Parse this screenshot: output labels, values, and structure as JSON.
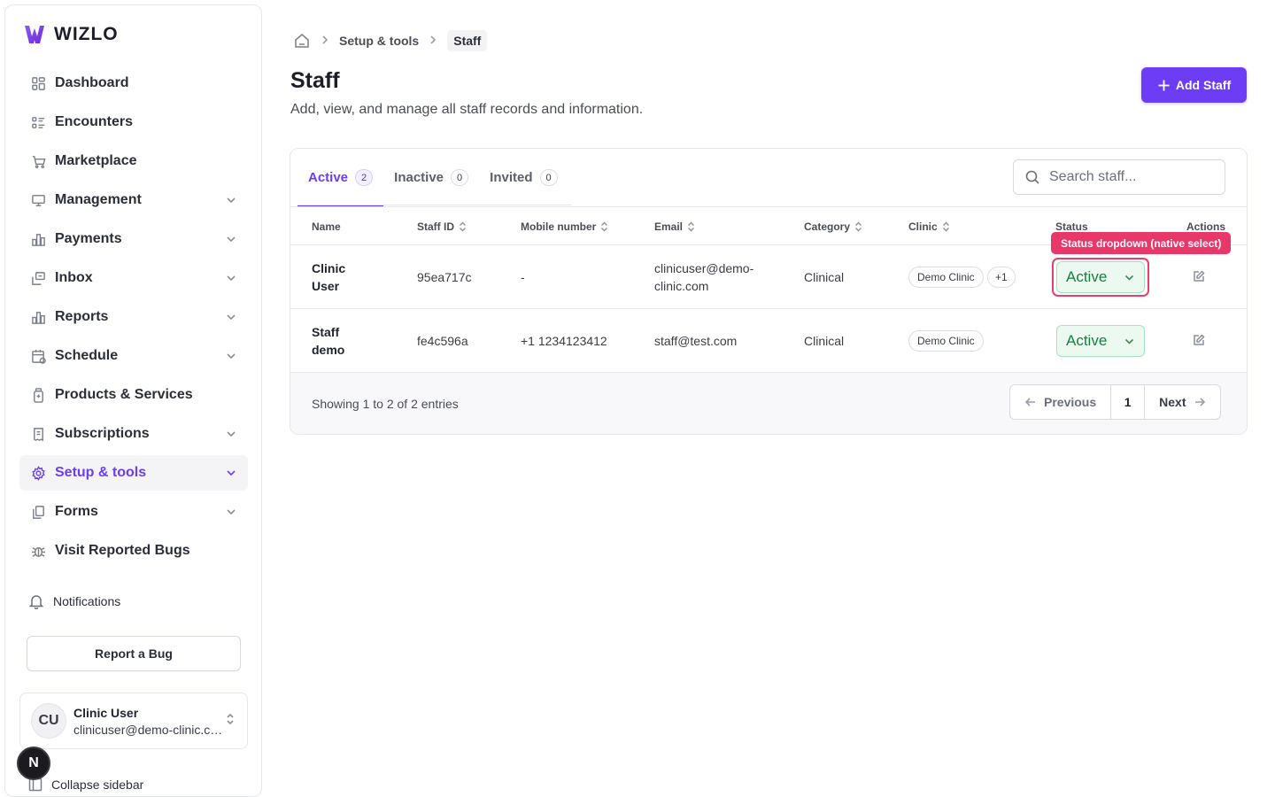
{
  "brand": {
    "name": "WIZLO"
  },
  "sidebar": {
    "items": [
      {
        "label": "Dashboard",
        "icon": "dashboard-icon",
        "expandable": false,
        "active": false
      },
      {
        "label": "Encounters",
        "icon": "encounters-icon",
        "expandable": false,
        "active": false
      },
      {
        "label": "Marketplace",
        "icon": "cart-icon",
        "expandable": false,
        "active": false
      },
      {
        "label": "Management",
        "icon": "monitor-icon",
        "expandable": true,
        "active": false
      },
      {
        "label": "Payments",
        "icon": "bar-chart-icon",
        "expandable": true,
        "active": false
      },
      {
        "label": "Inbox",
        "icon": "inbox-icon",
        "expandable": true,
        "active": false
      },
      {
        "label": "Reports",
        "icon": "bar-chart-icon",
        "expandable": true,
        "active": false
      },
      {
        "label": "Schedule",
        "icon": "calendar-icon",
        "expandable": true,
        "active": false
      },
      {
        "label": "Products & Services",
        "icon": "bottle-icon",
        "expandable": false,
        "active": false
      },
      {
        "label": "Subscriptions",
        "icon": "receipt-icon",
        "expandable": true,
        "active": false
      },
      {
        "label": "Setup & tools",
        "icon": "gear-icon",
        "expandable": true,
        "active": true
      },
      {
        "label": "Forms",
        "icon": "files-icon",
        "expandable": true,
        "active": false
      },
      {
        "label": "Visit Reported Bugs",
        "icon": "bug-icon",
        "expandable": false,
        "active": false
      }
    ],
    "notifications_label": "Notifications",
    "report_bug_label": "Report a Bug",
    "user": {
      "initials": "CU",
      "name": "Clinic User",
      "email": "clinicuser@demo-clinic.com"
    },
    "collapse_label": "Collapse sidebar",
    "floating_badge": "N"
  },
  "breadcrumb": {
    "items": [
      "Setup & tools"
    ],
    "current": "Staff"
  },
  "header": {
    "title": "Staff",
    "subtitle": "Add, view, and manage all staff records and information.",
    "add_button_label": "Add Staff"
  },
  "tabs": [
    {
      "label": "Active",
      "count": "2",
      "active": true
    },
    {
      "label": "Inactive",
      "count": "0",
      "active": false
    },
    {
      "label": "Invited",
      "count": "0",
      "active": false
    }
  ],
  "search": {
    "placeholder": "Search staff..."
  },
  "table": {
    "columns": [
      "Name",
      "Staff ID",
      "Mobile number",
      "Email",
      "Category",
      "Clinic",
      "Status",
      "Actions"
    ],
    "rows": [
      {
        "name_line1": "Clinic",
        "name_line2": "User",
        "staff_id": "95ea717c",
        "mobile": "-",
        "email_line1": "clinicuser@demo-",
        "email_line2": "clinic.com",
        "category": "Clinical",
        "clinic": "Demo Clinic",
        "clinic_extra": "+1",
        "status": "Active"
      },
      {
        "name_line1": "Staff",
        "name_line2": "demo",
        "staff_id": "fe4c596a",
        "mobile": "+1 1234123412",
        "email_line1": "staff@test.com",
        "email_line2": "",
        "category": "Clinical",
        "clinic": "Demo Clinic",
        "clinic_extra": "",
        "status": "Active"
      }
    ]
  },
  "annotation": {
    "tooltip": "Status dropdown (native select)"
  },
  "footer": {
    "showing_text": "Showing 1 to 2 of 2 entries",
    "previous_label": "Previous",
    "current_page": "1",
    "next_label": "Next"
  },
  "colors": {
    "accent": "#6d3df5",
    "status_green": "#16803f",
    "highlight": "#e83e6b"
  }
}
